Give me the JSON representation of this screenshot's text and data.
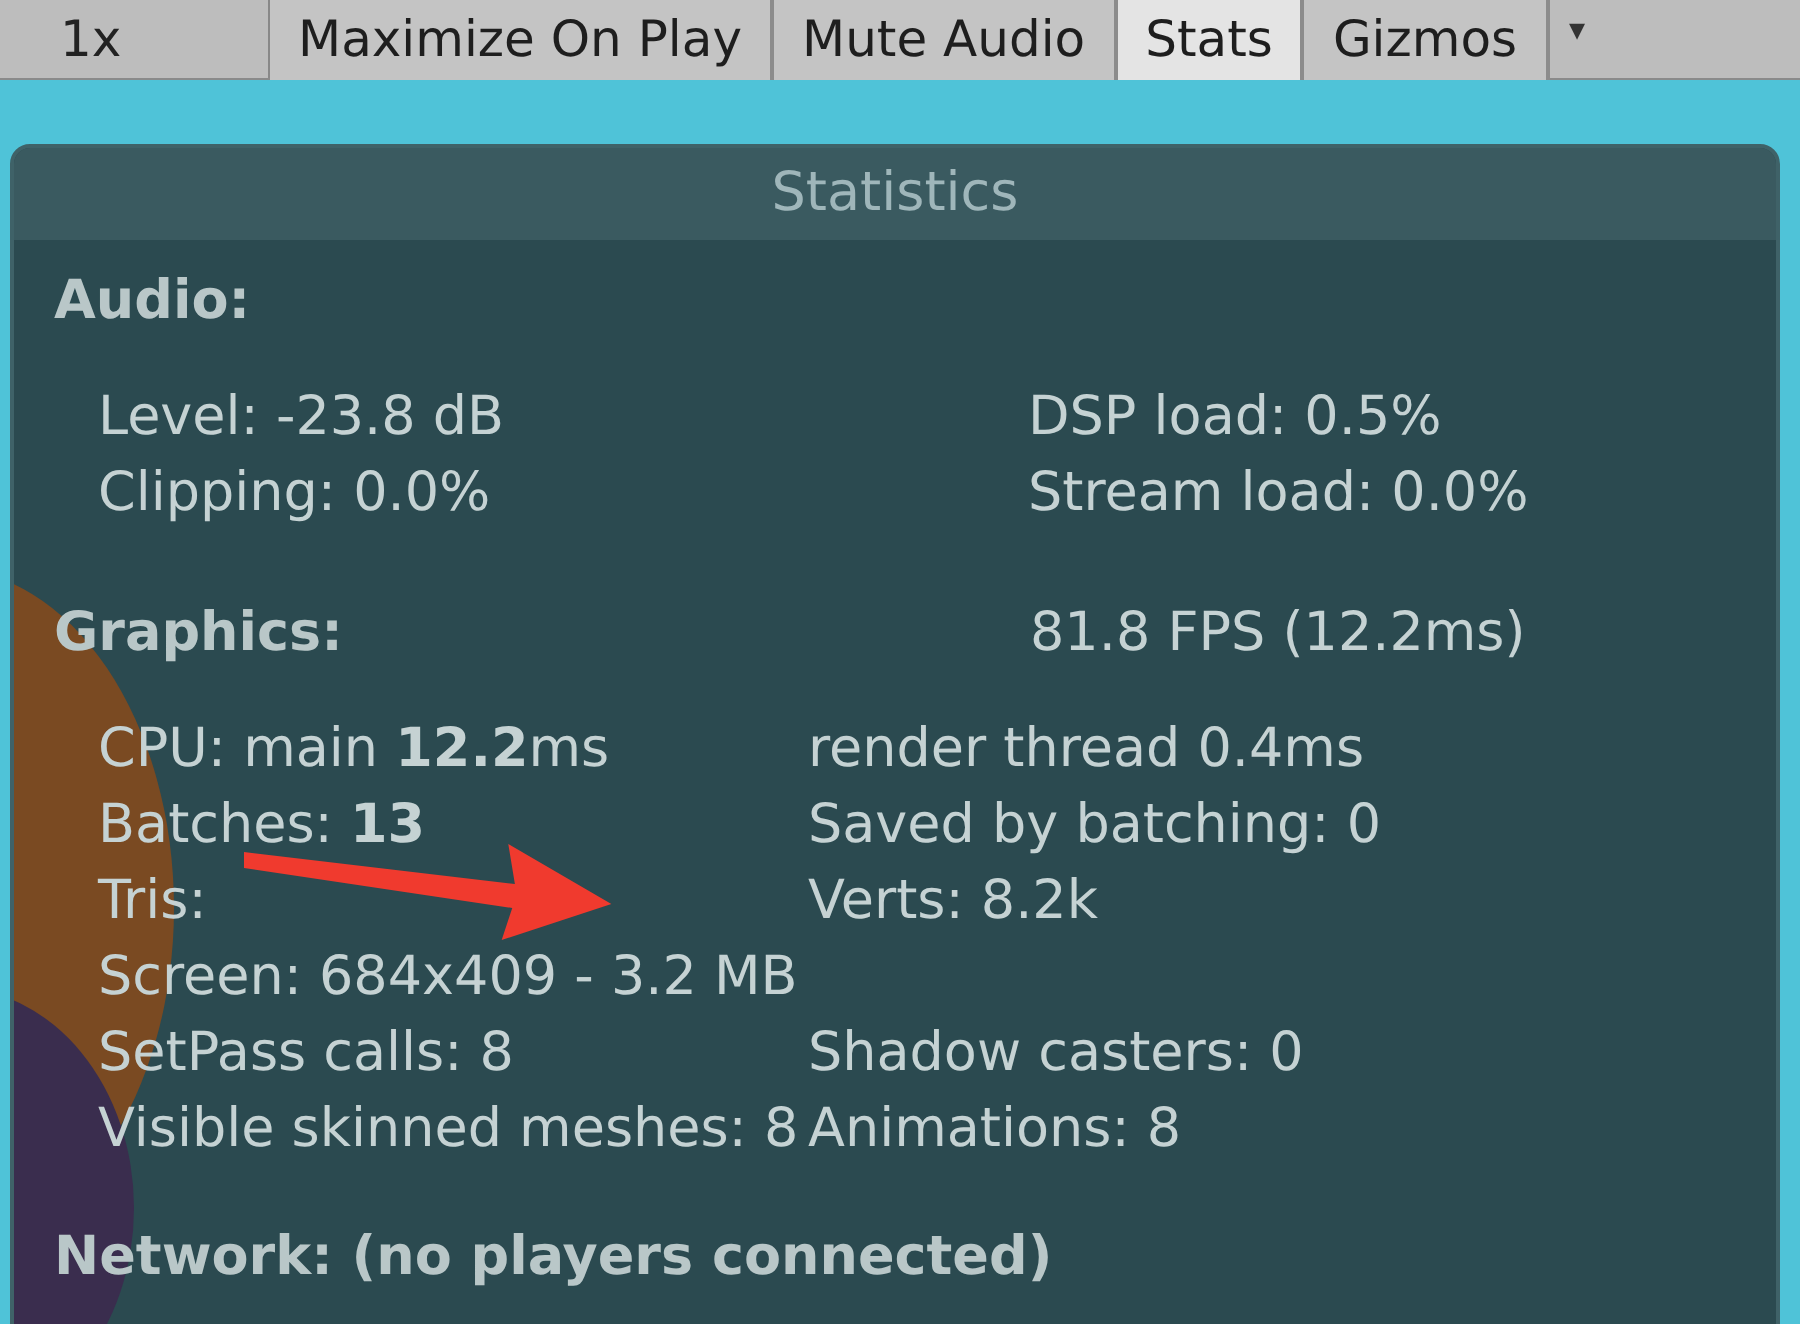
{
  "toolbar": {
    "scale_label": "1x",
    "buttons": [
      {
        "label": "Maximize On Play",
        "selected": false
      },
      {
        "label": "Mute Audio",
        "selected": false
      },
      {
        "label": "Stats",
        "selected": true
      },
      {
        "label": "Gizmos",
        "selected": false
      }
    ],
    "dropdown_caret": "▾"
  },
  "panel": {
    "title": "Statistics",
    "sections": [
      {
        "heading": "Audio:",
        "kind": "audio",
        "rows": [
          {
            "left": "Level: -23.8 dB",
            "right": "DSP load: 0.5%"
          },
          {
            "left": "Clipping: 0.0%",
            "right": "Stream load: 0.0%"
          }
        ]
      },
      {
        "heading": "Graphics:",
        "heading_right": "81.8 FPS (12.2ms)",
        "kind": "graphics",
        "rows": [
          {
            "left": "CPU: main **12.2**ms",
            "right": "render thread 0.4ms"
          },
          {
            "left": "Batches: **13**",
            "right": "Saved by batching: 0"
          },
          {
            "left": "Tris:",
            "right": "Verts: 8.2k"
          },
          {
            "left": "Screen: 684x409 - 3.2 MB"
          },
          {
            "left": "SetPass calls: 8",
            "right": "Shadow casters: 0"
          },
          {
            "left": "Visible skinned meshes: 8",
            "right": "Animations: 8"
          }
        ]
      },
      {
        "heading": "Network: (no players connected)",
        "kind": "network"
      }
    ]
  }
}
